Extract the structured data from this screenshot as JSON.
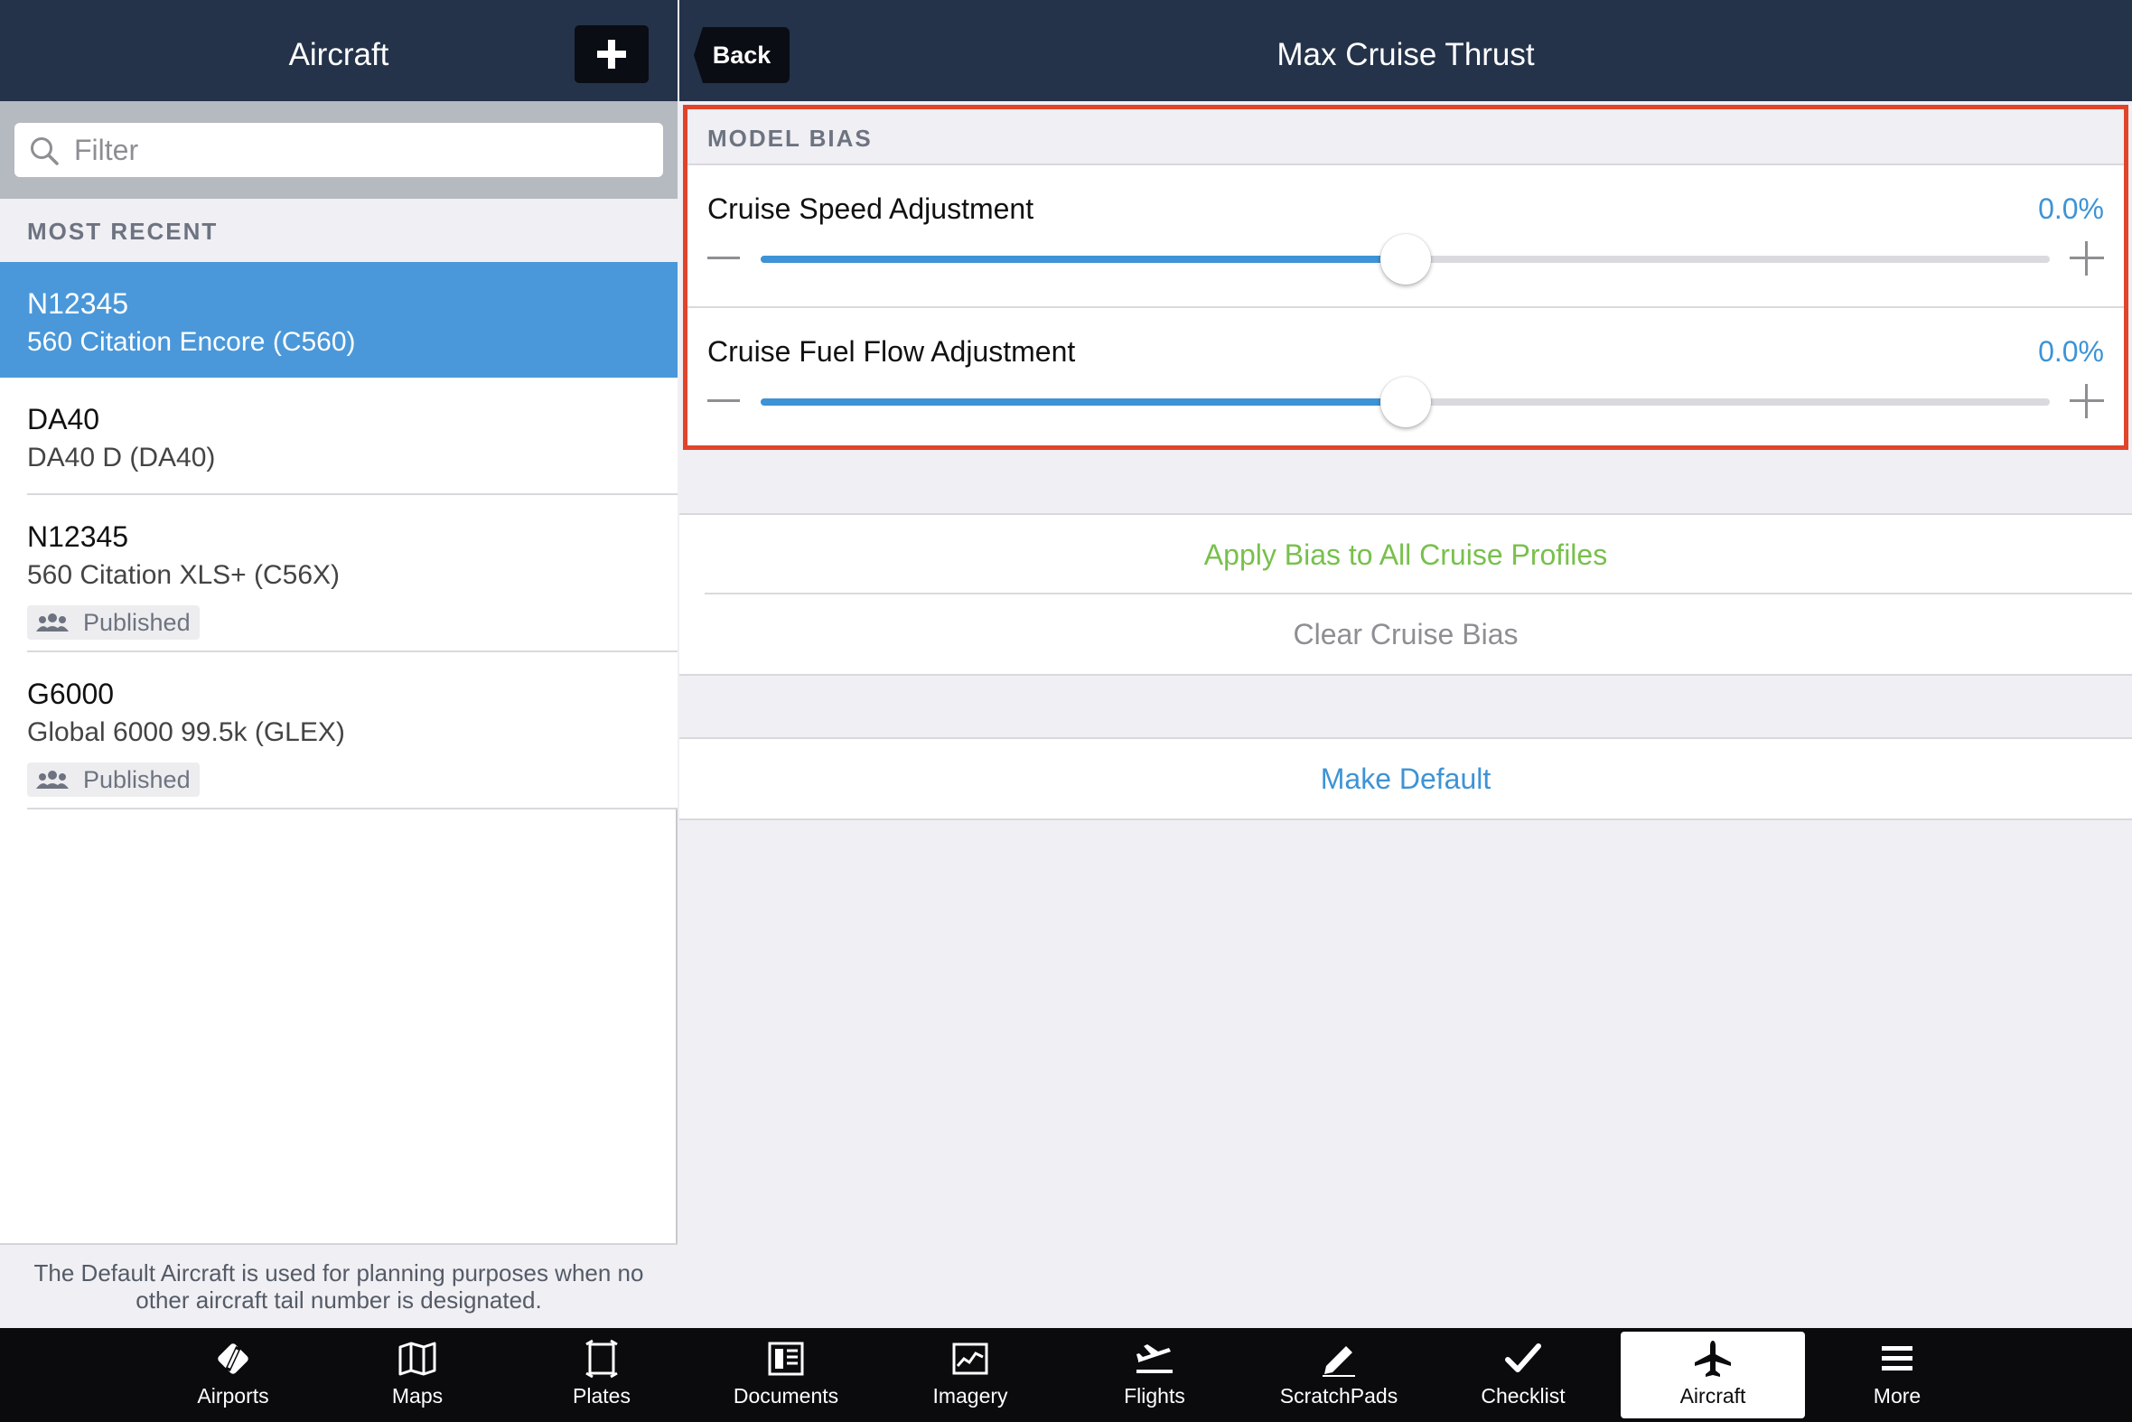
{
  "left": {
    "title": "Aircraft",
    "filter_placeholder": "Filter",
    "section_header": "MOST RECENT",
    "items": [
      {
        "tail": "N12345",
        "model": "560 Citation Encore (C560)",
        "selected": true,
        "badge": ""
      },
      {
        "tail": "DA40",
        "model": "DA40 D (DA40)",
        "selected": false,
        "badge": ""
      },
      {
        "tail": "N12345",
        "model": "560 Citation XLS+ (C56X)",
        "selected": false,
        "badge": "Published"
      },
      {
        "tail": "G6000",
        "model": "Global 6000 99.5k (GLEX)",
        "selected": false,
        "badge": "Published"
      }
    ],
    "footer_note": "The Default Aircraft is used for planning purposes when no other aircraft tail number is designated."
  },
  "right": {
    "back_label": "Back",
    "title": "Max Cruise Thrust",
    "section_header": "MODEL BIAS",
    "sliders": [
      {
        "label": "Cruise Speed Adjustment",
        "value_text": "0.0%",
        "level": 0.5
      },
      {
        "label": "Cruise Fuel Flow Adjustment",
        "value_text": "0.0%",
        "level": 0.5
      }
    ],
    "actions": {
      "apply_bias": "Apply Bias to All Cruise Profiles",
      "clear_bias": "Clear Cruise Bias",
      "make_default": "Make Default"
    }
  },
  "tabs": [
    {
      "label": "Airports",
      "icon": "airports-icon"
    },
    {
      "label": "Maps",
      "icon": "maps-icon"
    },
    {
      "label": "Plates",
      "icon": "plates-icon"
    },
    {
      "label": "Documents",
      "icon": "documents-icon"
    },
    {
      "label": "Imagery",
      "icon": "imagery-icon"
    },
    {
      "label": "Flights",
      "icon": "flights-icon"
    },
    {
      "label": "ScratchPads",
      "icon": "scratchpads-icon"
    },
    {
      "label": "Checklist",
      "icon": "checklist-icon"
    },
    {
      "label": "Aircraft",
      "icon": "aircraft-icon",
      "active": true
    },
    {
      "label": "More",
      "icon": "more-icon"
    }
  ],
  "colors": {
    "navbar": "#24334a",
    "selected_row": "#4a98d9",
    "accent_blue": "#3d93d6",
    "accent_green": "#78c04c",
    "highlight_border": "#e0452b"
  }
}
